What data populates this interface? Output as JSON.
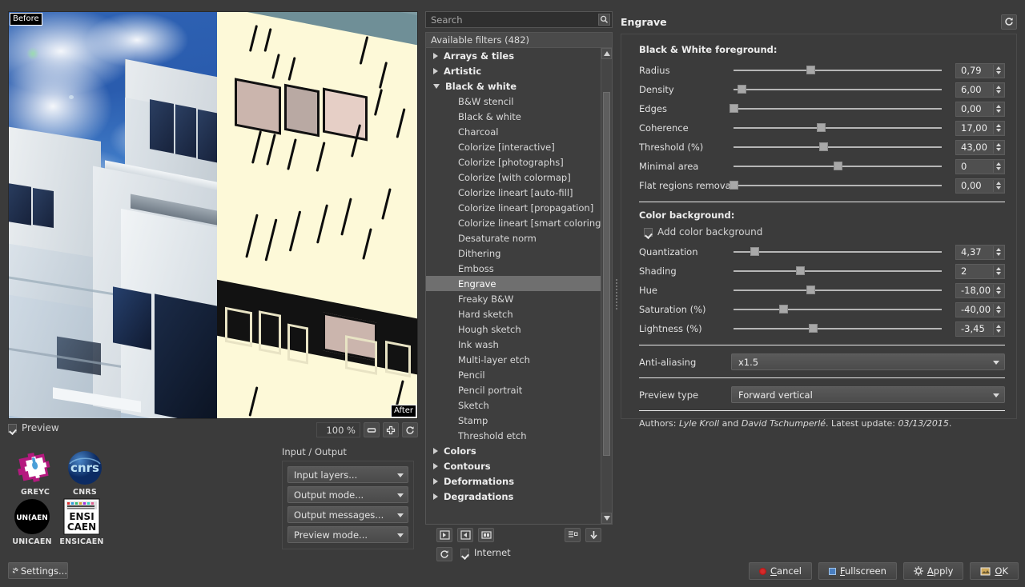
{
  "preview": {
    "before_tag": "Before",
    "after_tag": "After",
    "checkbox_label": "Preview",
    "checked": true,
    "zoom_value": "100 %",
    "buttons": [
      {
        "name": "zoom-minus-button",
        "icon": "minus-icon"
      },
      {
        "name": "zoom-fit-button",
        "icon": "move-icon"
      },
      {
        "name": "zoom-reset-button",
        "icon": "refresh-icon"
      }
    ]
  },
  "logos": [
    {
      "caption": "GREYC",
      "mark": "greyc-logo"
    },
    {
      "caption": "CNRS",
      "mark": "cnrs-logo"
    },
    {
      "caption": "UNICAEN",
      "mark": "unicaen-logo"
    },
    {
      "caption": "ENSICAEN",
      "mark": "ensicaen-logo"
    }
  ],
  "io": {
    "title": "Input / Output",
    "combos": [
      {
        "label": "Input layers...",
        "name": "input-layers-combo"
      },
      {
        "label": "Output mode...",
        "name": "output-mode-combo"
      },
      {
        "label": "Output messages...",
        "name": "output-messages-combo"
      },
      {
        "label": "Preview mode...",
        "name": "preview-mode-combo"
      }
    ]
  },
  "settings_button": "Settings...",
  "filters": {
    "search_placeholder": "Search",
    "search_value": "",
    "header": "Available filters (482)",
    "items": [
      {
        "label": "Arrays & tiles",
        "type": "category",
        "expanded": false
      },
      {
        "label": "Artistic",
        "type": "category",
        "expanded": false
      },
      {
        "label": "Black & white",
        "type": "category",
        "expanded": true
      },
      {
        "label": "B&W stencil",
        "type": "leaf",
        "selected": false
      },
      {
        "label": "Black & white",
        "type": "leaf",
        "selected": false
      },
      {
        "label": "Charcoal",
        "type": "leaf",
        "selected": false
      },
      {
        "label": "Colorize [interactive]",
        "type": "leaf",
        "selected": false
      },
      {
        "label": "Colorize [photographs]",
        "type": "leaf",
        "selected": false
      },
      {
        "label": "Colorize [with colormap]",
        "type": "leaf",
        "selected": false
      },
      {
        "label": "Colorize lineart [auto-fill]",
        "type": "leaf",
        "selected": false
      },
      {
        "label": "Colorize lineart [propagation]",
        "type": "leaf",
        "selected": false
      },
      {
        "label": "Colorize lineart [smart coloring]",
        "type": "leaf",
        "selected": false
      },
      {
        "label": "Desaturate norm",
        "type": "leaf",
        "selected": false
      },
      {
        "label": "Dithering",
        "type": "leaf",
        "selected": false
      },
      {
        "label": "Emboss",
        "type": "leaf",
        "selected": false
      },
      {
        "label": "Engrave",
        "type": "leaf",
        "selected": true
      },
      {
        "label": "Freaky B&W",
        "type": "leaf",
        "selected": false
      },
      {
        "label": "Hard sketch",
        "type": "leaf",
        "selected": false
      },
      {
        "label": "Hough sketch",
        "type": "leaf",
        "selected": false
      },
      {
        "label": "Ink wash",
        "type": "leaf",
        "selected": false
      },
      {
        "label": "Multi-layer etch",
        "type": "leaf",
        "selected": false
      },
      {
        "label": "Pencil",
        "type": "leaf",
        "selected": false
      },
      {
        "label": "Pencil portrait",
        "type": "leaf",
        "selected": false
      },
      {
        "label": "Sketch",
        "type": "leaf",
        "selected": false
      },
      {
        "label": "Stamp",
        "type": "leaf",
        "selected": false
      },
      {
        "label": "Threshold etch",
        "type": "leaf",
        "selected": false
      },
      {
        "label": "Colors",
        "type": "category",
        "expanded": false
      },
      {
        "label": "Contours",
        "type": "category",
        "expanded": false
      },
      {
        "label": "Deformations",
        "type": "category",
        "expanded": false
      },
      {
        "label": "Degradations",
        "type": "category",
        "expanded": false
      }
    ],
    "toolbar": [
      {
        "name": "add-fave-button",
        "icon": "add-favorite-icon"
      },
      {
        "name": "remove-fave-button",
        "icon": "remove-favorite-icon"
      },
      {
        "name": "rename-fave-button",
        "icon": "rename-favorite-icon"
      },
      {
        "name": "expand-collapse-button",
        "icon": "list-expand-icon"
      },
      {
        "name": "download-filters-button",
        "icon": "download-arrow-icon"
      }
    ],
    "refresh_button": {
      "name": "refresh-filters-button",
      "icon": "refresh-icon"
    },
    "internet_label": "Internet",
    "internet_checked": true
  },
  "params": {
    "title": "Engrave",
    "reset_icon": "refresh-icon",
    "group_bw": "Black & White foreground:",
    "group_color": "Color background:",
    "add_color_background": {
      "label": "Add color background",
      "checked": true
    },
    "sliders_bw": [
      {
        "label": "Radius",
        "value": "0,79",
        "pct": 37,
        "track_left": 0
      },
      {
        "label": "Density",
        "value": "6,00",
        "pct": 4,
        "track_left": 0
      },
      {
        "label": "Edges",
        "value": "0,00",
        "pct": 0,
        "track_left": 0
      },
      {
        "label": "Coherence",
        "value": "17,00",
        "pct": 42,
        "track_left": 0
      },
      {
        "label": "Threshold (%)",
        "value": "43,00",
        "pct": 43,
        "track_left": 0
      },
      {
        "label": "Minimal area",
        "value": "0",
        "pct": 50,
        "track_left": 0
      },
      {
        "label": "Flat regions removal",
        "value": "0,00",
        "pct": 0,
        "track_left": 0
      }
    ],
    "sliders_color": [
      {
        "label": "Quantization",
        "value": "4,37",
        "pct": 10
      },
      {
        "label": "Shading",
        "value": "2",
        "pct": 32
      },
      {
        "label": "Hue",
        "value": "-18,00",
        "pct": 37
      },
      {
        "label": "Saturation (%)",
        "value": "-40,00",
        "pct": 24
      },
      {
        "label": "Lightness (%)",
        "value": "-3,45",
        "pct": 38
      }
    ],
    "selects": [
      {
        "label": "Anti-aliasing",
        "value": "x1.5",
        "name": "anti-aliasing-select"
      },
      {
        "label": "Preview type",
        "value": "Forward vertical",
        "name": "preview-type-select"
      }
    ],
    "authors_prefix": "Authors: ",
    "authors_a": "Lyle Kroll",
    "authors_mid": " and ",
    "authors_b": "David Tschumperlé",
    "authors_update_label": ". Latest update: ",
    "authors_date": "03/13/2015",
    "authors_suffix": "."
  },
  "footer": {
    "cancel": "Cancel",
    "fullscreen": "Fullscreen",
    "apply": "Apply",
    "ok": "OK"
  },
  "colors": {
    "window_bg": "#3b3b3b",
    "panel_bg": "#3e3e3e",
    "selection": "#6f6f6f",
    "text": "#d9d9d9",
    "cancel_red": "#d62b2b"
  }
}
